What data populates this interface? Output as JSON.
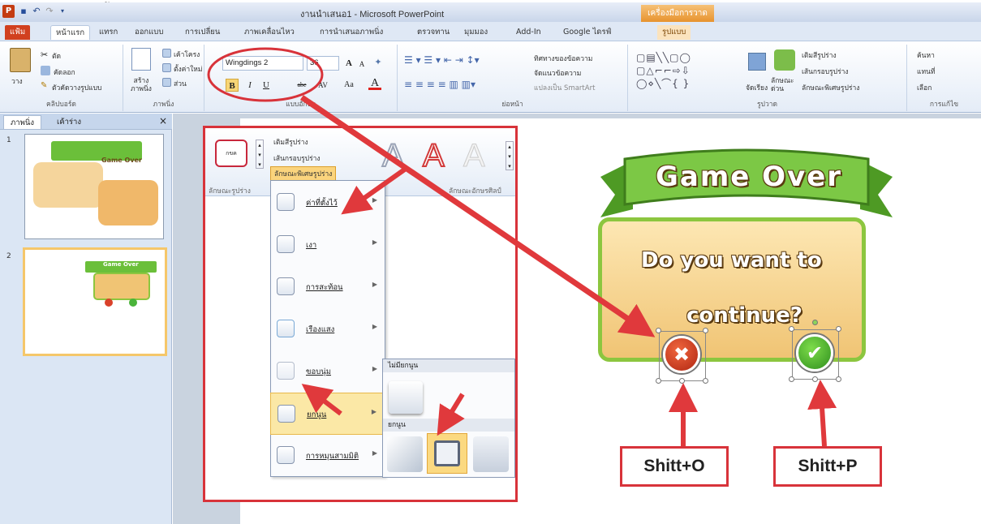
{
  "window": {
    "title": "งานนำเสนอ1 - Microsoft PowerPoint",
    "app_icon_letter": "P",
    "contextual_tab_group": "เครื่องมือการวาด",
    "corner_char": "ข"
  },
  "tabs": [
    "แฟ้ม",
    "หน้าแรก",
    "แทรก",
    "ออกแบบ",
    "การเปลี่ยน",
    "ภาพเคลื่อนไหว",
    "การนำเสนอภาพนิ่ง",
    "ตรวจทาน",
    "มุมมอง",
    "Add-In",
    "Google ไดรฟ์",
    "รูปแบบ"
  ],
  "ribbon": {
    "clipboard": {
      "paste": "วาง",
      "cut": "ตัด",
      "copy": "คัดลอก",
      "format_painter": "ตัวคัดวางรูปแบบ",
      "label": "คลิปบอร์ด"
    },
    "slides": {
      "new_slide": "สร้าง ภาพนิ่ง",
      "layout": "เค้าโครง",
      "reset": "ตั้งค่าใหม่",
      "section": "ส่วน",
      "label": "ภาพนิ่ง"
    },
    "font": {
      "name": "Wingdings 2",
      "size": "36",
      "label": "แบบอักษร",
      "bold": "B",
      "italic": "I",
      "underline": "U",
      "strike": "abe",
      "spacing": "AV",
      "case": "Aa",
      "color": "A",
      "grow": "A",
      "shrink": "A"
    },
    "paragraph": {
      "text_direction": "ทิศทางของข้อความ",
      "align_text": "จัดแนวข้อความ",
      "smartart": "แปลงเป็น SmartArt",
      "label": "ย่อหน้า"
    },
    "drawing": {
      "arrange": "จัดเรียง",
      "quick_styles": "ลักษณะ ด่วน",
      "fill": "เติมสีรูปร่าง",
      "outline": "เส้นกรอบรูปร่าง",
      "effects": "ลักษณะพิเศษรูปร่าง",
      "label": "รูปวาด"
    },
    "editing": {
      "find": "ค้นหา",
      "replace": "แทนที่",
      "select": "เลือก",
      "label": "การแก้ไข"
    }
  },
  "left_panel": {
    "tabs": [
      "ภาพนิ่ง",
      "เค้าร่าง"
    ],
    "close": "×",
    "slide_numbers": [
      "1",
      "2"
    ]
  },
  "overlay": {
    "fill": "เติมสีรูปร่าง",
    "outline": "เส้นกรอบรูปร่าง",
    "effects": "ลักษณะพิเศษรูปร่าง",
    "style_box_text": "กขค",
    "shape_styles_label": "ลักษณะรูปร่าง",
    "wordart_styles_label": "ลักษณะอักษรศิลป์",
    "wordart_letters": [
      "A",
      "A",
      "A"
    ],
    "menu": [
      "ค่าที่ตั้งไว้",
      "เงา",
      "การสะท้อน",
      "เรืองแสง",
      "ขอบนุ่ม",
      "ยกนูน",
      "การหมุนสามมิติ"
    ],
    "submenu_no_bevel": "ไม่มียกนูน",
    "submenu_bevel": "ยกนูน"
  },
  "game": {
    "title": "Game Over",
    "question_line1": "Do you want to",
    "question_line2": "continue?",
    "thumb_title": "Game Over",
    "btn_no": "✖",
    "btn_yes": "✔",
    "shortcut_left": "Shitt+O",
    "shortcut_right": "Shitt+P"
  }
}
